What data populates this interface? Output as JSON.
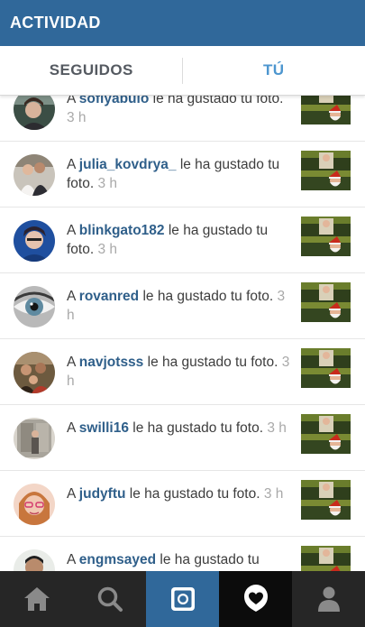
{
  "header": {
    "title": "ACTIVIDAD"
  },
  "tabs": [
    {
      "label": "SEGUIDOS"
    },
    {
      "label": "TÚ"
    }
  ],
  "activity": {
    "prefix": "A",
    "items": [
      {
        "username": "sofiyabulo",
        "message": "le ha gustado tu foto.",
        "time": "3 h"
      },
      {
        "username": "julia_kovdrya_",
        "message": "le ha gustado tu foto.",
        "time": "3 h"
      },
      {
        "username": "blinkgato182",
        "message": "le ha gustado tu foto.",
        "time": "3 h"
      },
      {
        "username": "rovanred",
        "message": "le ha gustado tu foto.",
        "time": "3 h"
      },
      {
        "username": "navjotsss",
        "message": "le ha gustado tu foto.",
        "time": "3 h"
      },
      {
        "username": "swilli16",
        "message": "le ha gustado tu foto.",
        "time": "3 h"
      },
      {
        "username": "judyftu",
        "message": "le ha gustado tu foto.",
        "time": "3 h"
      },
      {
        "username": "engmsayed",
        "message": "le ha gustado tu",
        "time": ""
      }
    ]
  },
  "bottom_nav": [
    {
      "icon": "home-icon"
    },
    {
      "icon": "search-icon"
    },
    {
      "icon": "camera-icon"
    },
    {
      "icon": "activity-heart-icon"
    },
    {
      "icon": "profile-icon"
    }
  ],
  "colors": {
    "header_bg": "#30689a",
    "active_tab": "#4d96cf",
    "username": "#2f5f8a",
    "nav_bg": "#262626",
    "camera_bg": "#30689a"
  }
}
